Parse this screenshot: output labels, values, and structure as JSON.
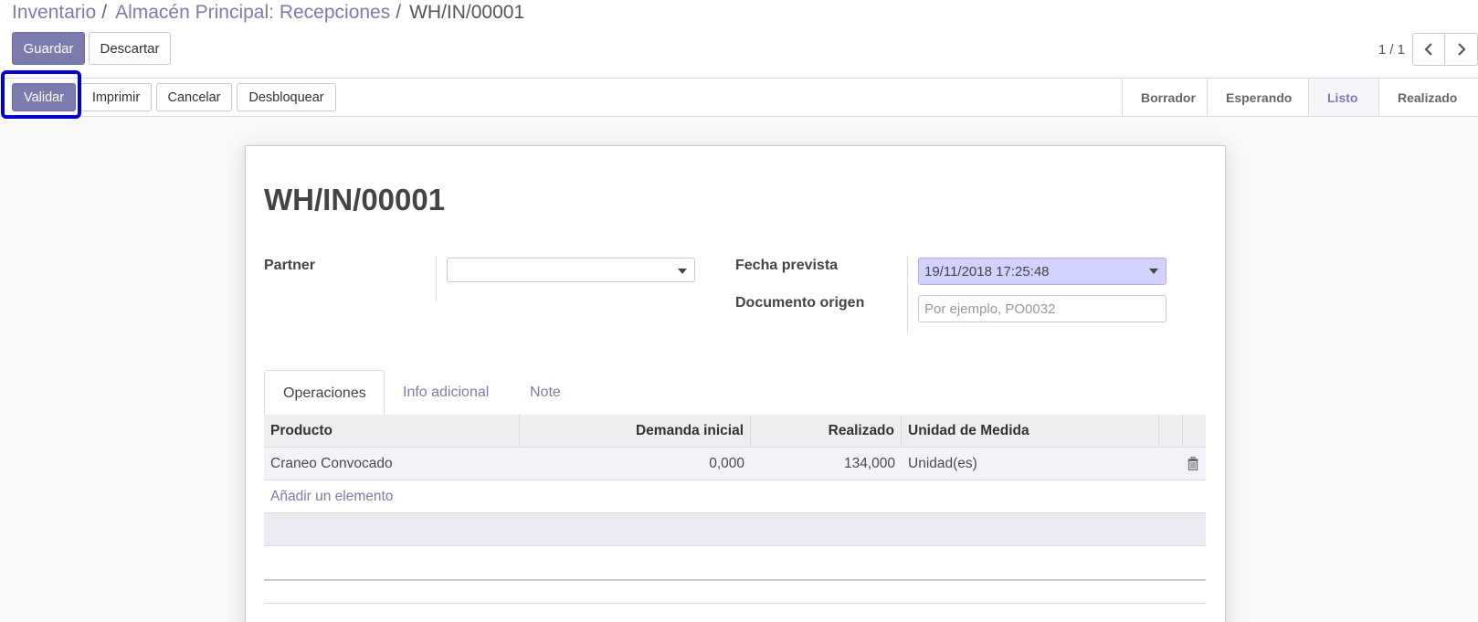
{
  "breadcrumb": {
    "items": [
      "Inventario",
      "Almacén Principal: Recepciones"
    ],
    "separator": "/",
    "current": "WH/IN/00001"
  },
  "actions": {
    "save_label": "Guardar",
    "discard_label": "Descartar"
  },
  "pager": {
    "value": "1 / 1"
  },
  "statusbar": {
    "buttons": [
      "Validar",
      "Imprimir",
      "Cancelar",
      "Desbloquear"
    ],
    "stages": [
      "Borrador",
      "Esperando",
      "Listo",
      "Realizado"
    ],
    "active_stage": "Listo"
  },
  "form": {
    "name": "WH/IN/00001",
    "partner_label": "Partner",
    "partner_value": "",
    "scheduled_date_label": "Fecha prevista",
    "scheduled_date_value": "19/11/2018 17:25:48",
    "origin_label": "Documento origen",
    "origin_placeholder": "Por ejemplo, PO0032"
  },
  "tabs": [
    "Operaciones",
    "Info adicional",
    "Note"
  ],
  "operations": {
    "columns": [
      "Producto",
      "Demanda inicial",
      "Realizado",
      "Unidad de Medida"
    ],
    "rows": [
      {
        "product": "Craneo Convocado",
        "demand": "0,000",
        "done": "134,000",
        "uom": "Unidad(es)"
      }
    ],
    "add_line_label": "Añadir un elemento"
  },
  "colors": {
    "primary": "#7c7bad",
    "highlight_box": "#0000d2",
    "date_field_bg": "#d2d2ff"
  }
}
